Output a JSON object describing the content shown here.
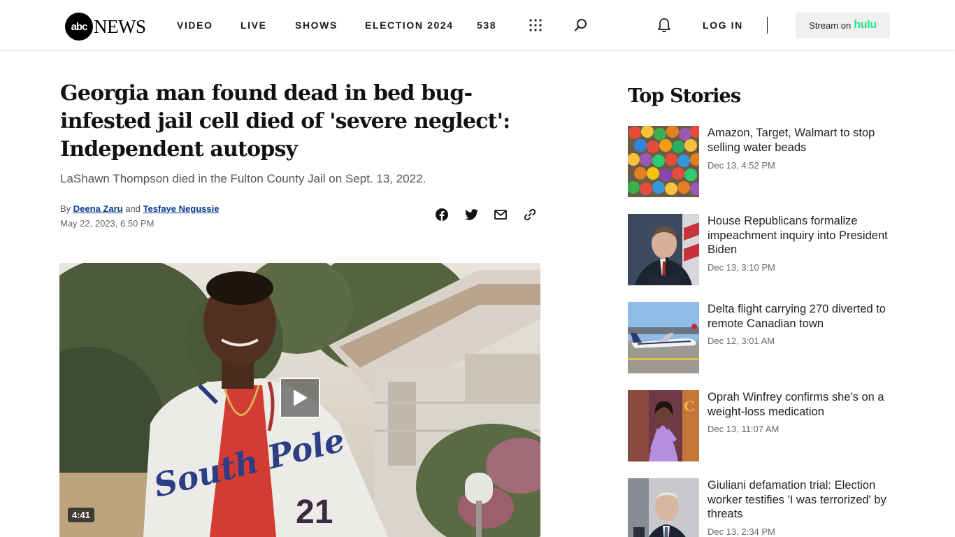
{
  "header": {
    "logo_mark": "abc",
    "logo_word": "NEWS",
    "nav": [
      "VIDEO",
      "LIVE",
      "SHOWS",
      "ELECTION 2024",
      "538"
    ],
    "login": "LOG IN",
    "stream_prefix": "Stream on",
    "stream_brand": "hulu"
  },
  "article": {
    "headline": "Georgia man found dead in bed bug-infested jail cell died of 'severe neglect': Independent autopsy",
    "dek": "LaShawn Thompson died in the Fulton County Jail on Sept. 13, 2022.",
    "by": "By",
    "author1": "Deena Zaru",
    "and": "and",
    "author2": "Tesfaye Negussie",
    "date": "May 22, 2023, 6:50 PM",
    "video_duration": "4:41",
    "shirt_text": "South Pole",
    "shirt_number": "21"
  },
  "sidebar": {
    "title": "Top Stories",
    "stories": [
      {
        "title": "Amazon, Target, Walmart to stop selling water beads",
        "time": "Dec 13, 4:52 PM"
      },
      {
        "title": "House Republicans formalize impeachment inquiry into President Biden",
        "time": "Dec 13, 3:10 PM"
      },
      {
        "title": "Delta flight carrying 270 diverted to remote Canadian town",
        "time": "Dec 12, 3:01 AM"
      },
      {
        "title": "Oprah Winfrey confirms she's on a weight-loss medication",
        "time": "Dec 13, 11:07 AM"
      },
      {
        "title": "Giuliani defamation trial: Election worker testifies 'I was terrorized' by threats",
        "time": "Dec 13, 2:34 PM"
      }
    ]
  },
  "icons": [
    "grid-icon",
    "search-icon",
    "bell-icon",
    "facebook-icon",
    "twitter-icon",
    "email-icon",
    "link-icon",
    "play-icon"
  ]
}
